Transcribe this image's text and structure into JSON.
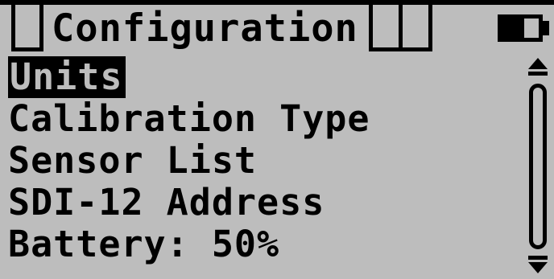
{
  "header": {
    "title": "Configuration",
    "battery_level": 0.6,
    "battery_icon": "battery-icon"
  },
  "menu": {
    "items": [
      {
        "label": "Units",
        "selected": true
      },
      {
        "label": "Calibration Type",
        "selected": false
      },
      {
        "label": "Sensor List",
        "selected": false
      },
      {
        "label": "SDI-12 Address",
        "selected": false
      },
      {
        "label": "Battery: 50%",
        "selected": false
      }
    ]
  },
  "scrollbar": {
    "up_icon": "scroll-up-arrow-icon",
    "down_icon": "scroll-down-arrow-icon"
  },
  "colors": {
    "background": "#bdbdbd",
    "foreground": "#000000"
  }
}
